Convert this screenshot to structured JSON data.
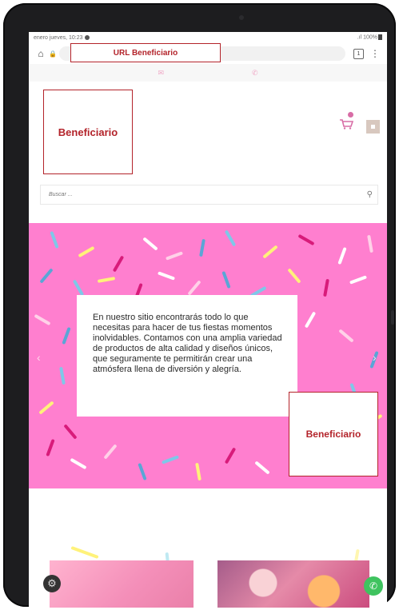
{
  "status_bar": {
    "datetime": "enero jueves, 10:23",
    "battery": "100%"
  },
  "browser": {
    "url_label": "URL Beneficiario",
    "tab_count": "1",
    "menu_glyph": "⋮",
    "home_glyph": "⌂",
    "lock_glyph": "🔒"
  },
  "topbar": {
    "mail_glyph": "✉",
    "phone_glyph": "✆"
  },
  "header": {
    "logo_label": "Beneficiario"
  },
  "search": {
    "placeholder": "Buscar ...",
    "icon_glyph": "⚲"
  },
  "hero": {
    "text": "En nuestro sitio encontrarás todo lo que necesitas para hacer de tus fiestas momentos inolvidables. Contamos con una amplia variedad de productos de alta calidad y diseños únicos, que seguramente te permitirán crear una atmósfera llena de diversión y alegría.",
    "badge_label": "Beneficiario",
    "prev_glyph": "‹",
    "next_glyph": "›"
  },
  "fabs": {
    "settings_glyph": "⚙",
    "whatsapp_glyph": "✆"
  },
  "colors": {
    "hero_bg": "#ff7fcf",
    "annotation_red": "#b3232a",
    "whatsapp_green": "#3fc35f"
  }
}
